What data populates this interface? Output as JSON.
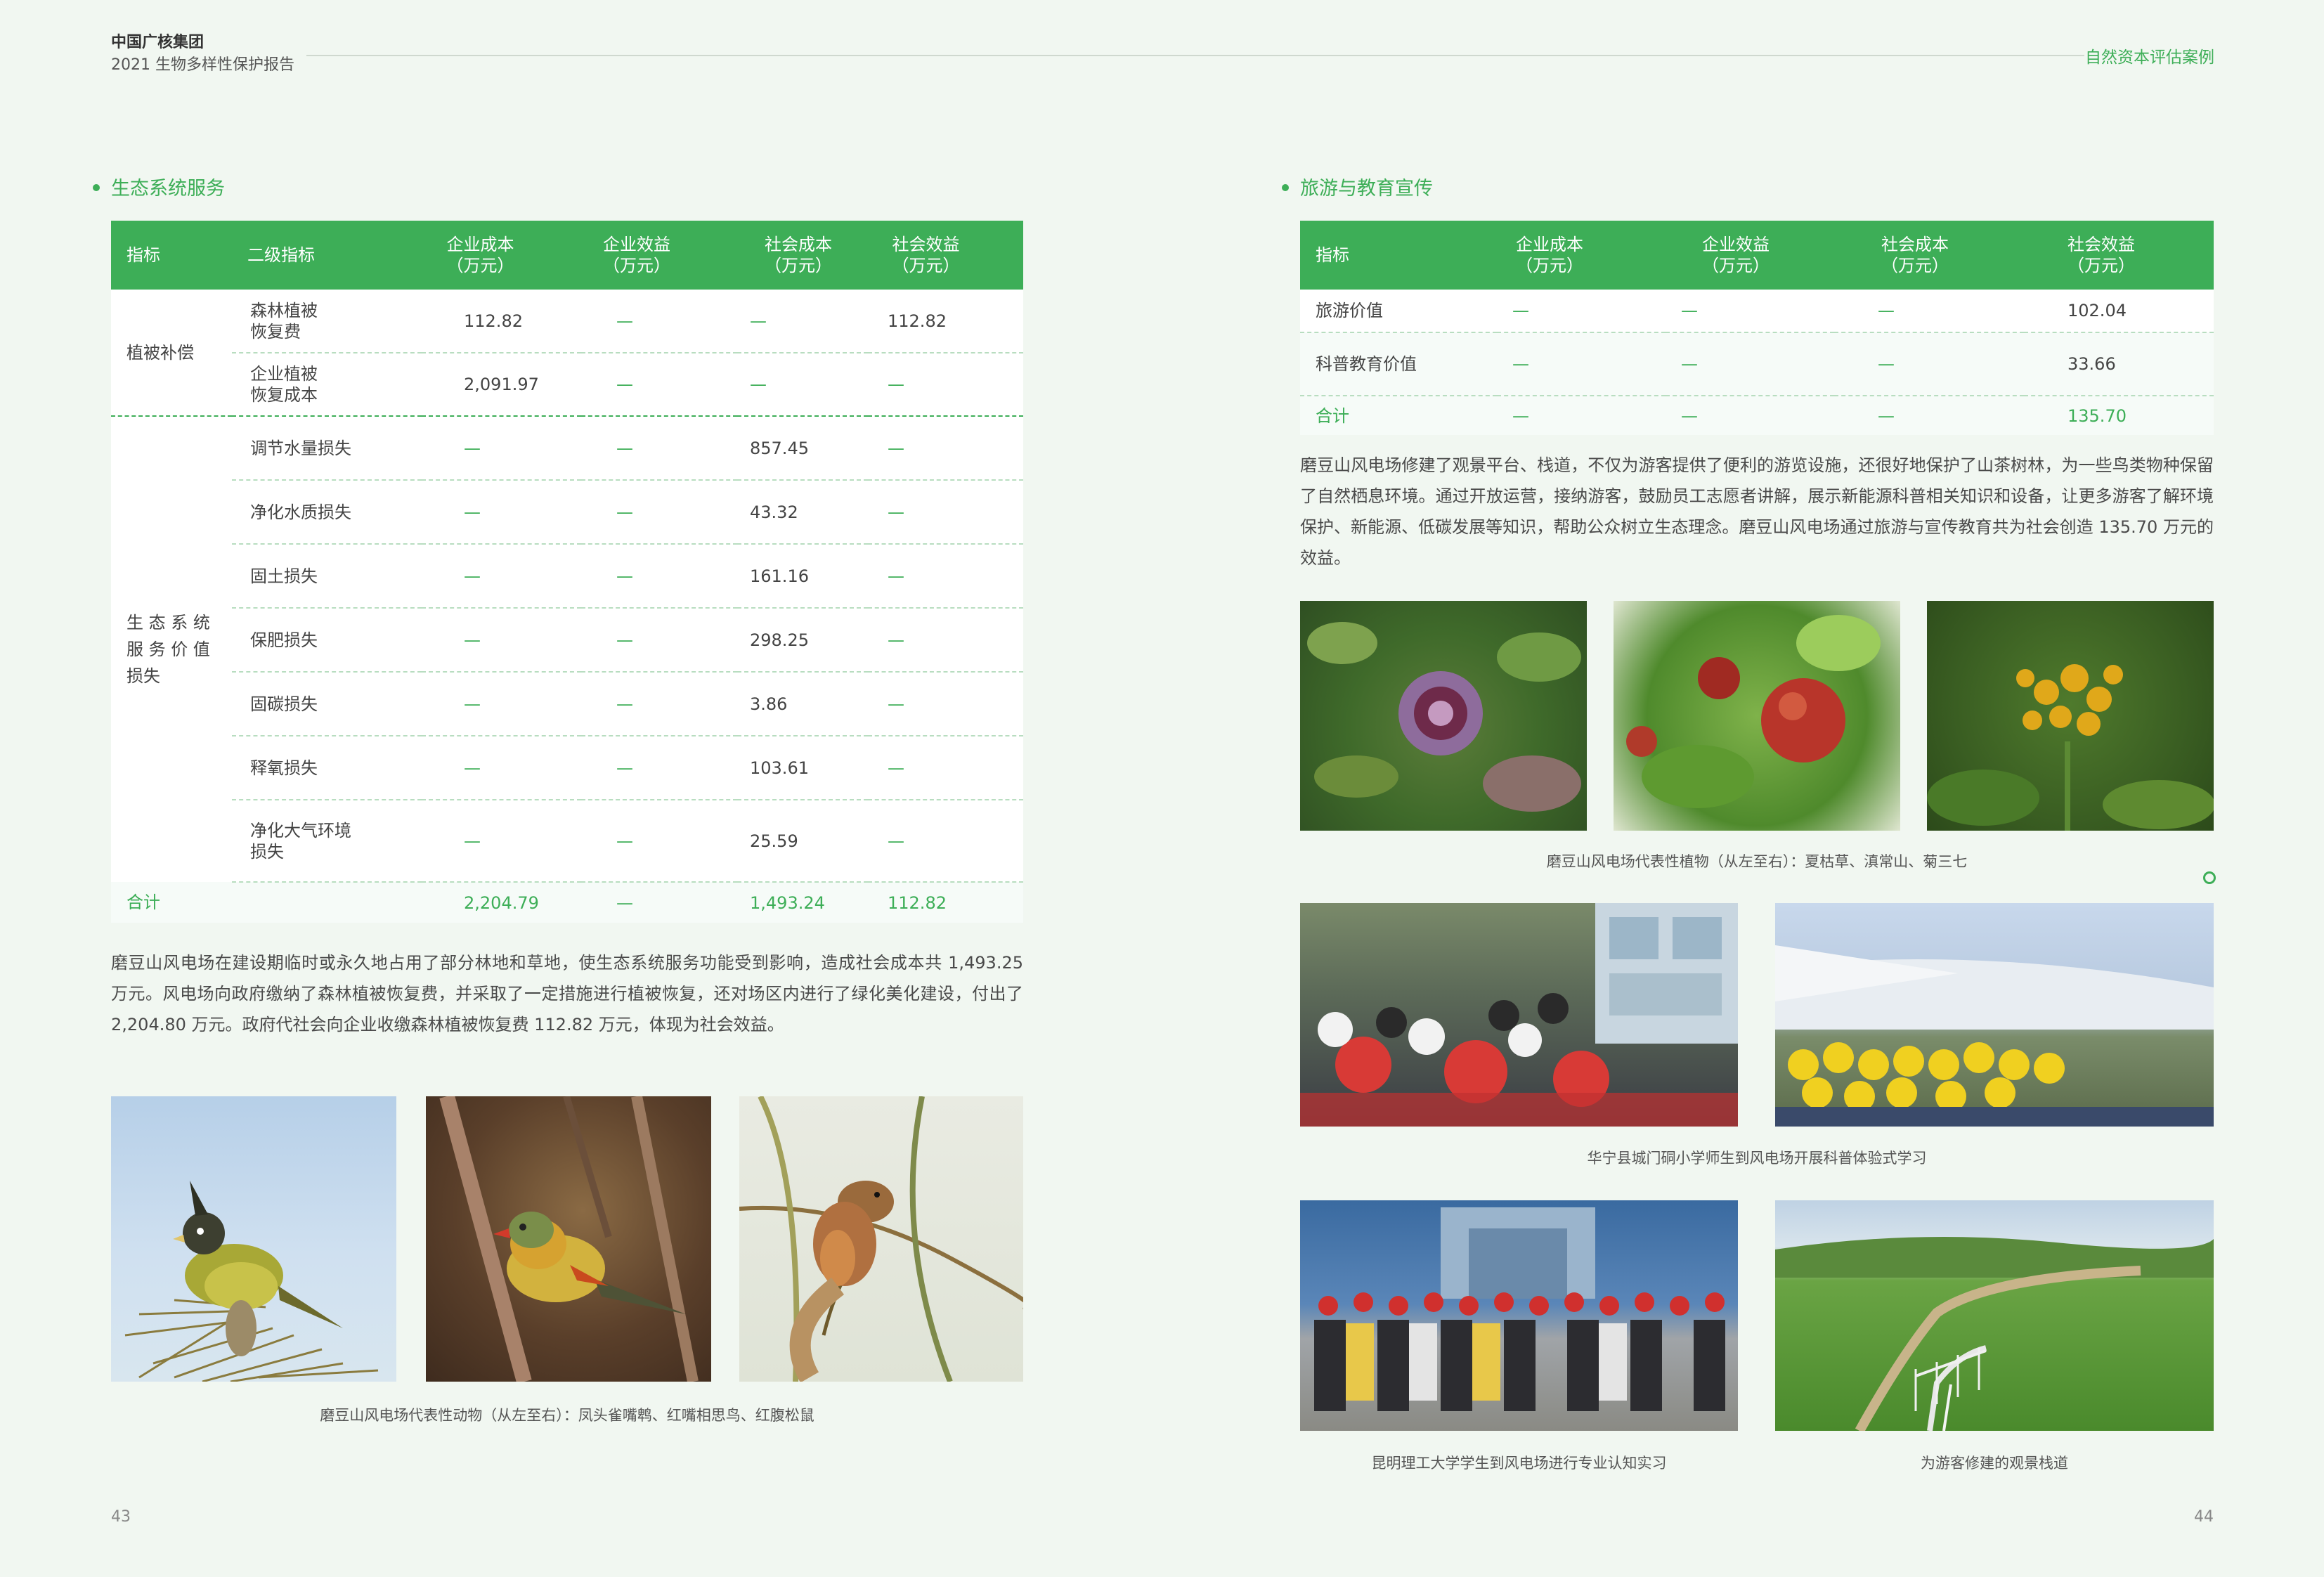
{
  "header": {
    "org": "中国广核集团",
    "report": "2021 生物多样性保护报告",
    "section": "自然资本评估案例"
  },
  "left": {
    "title": "生态系统服务",
    "table": {
      "headers": [
        "指标",
        "二级指标",
        "企业成本\n（万元）",
        "企业效益\n（万元）",
        "社会成本\n（万元）",
        "社会效益\n（万元）"
      ],
      "group1": {
        "name": "植被补偿",
        "rows": [
          {
            "name": "森林植被\n恢复费",
            "c1": "112.82",
            "c2": "—",
            "c3": "—",
            "c4": "112.82"
          },
          {
            "name": "企业植被\n恢复成本",
            "c1": "2,091.97",
            "c2": "—",
            "c3": "—",
            "c4": "—"
          }
        ]
      },
      "group2": {
        "name": "生 态 系 统\n服 务 价 值\n损失",
        "rows": [
          {
            "name": "调节水量损失",
            "c1": "—",
            "c2": "—",
            "c3": "857.45",
            "c4": "—"
          },
          {
            "name": "净化水质损失",
            "c1": "—",
            "c2": "—",
            "c3": "43.32",
            "c4": "—"
          },
          {
            "name": "固土损失",
            "c1": "—",
            "c2": "—",
            "c3": "161.16",
            "c4": "—"
          },
          {
            "name": "保肥损失",
            "c1": "—",
            "c2": "—",
            "c3": "298.25",
            "c4": "—"
          },
          {
            "name": "固碳损失",
            "c1": "—",
            "c2": "—",
            "c3": "3.86",
            "c4": "—"
          },
          {
            "name": "释氧损失",
            "c1": "—",
            "c2": "—",
            "c3": "103.61",
            "c4": "—"
          },
          {
            "name": "净化大气环境\n损失",
            "c1": "—",
            "c2": "—",
            "c3": "25.59",
            "c4": "—"
          }
        ]
      },
      "total": {
        "name": "合计",
        "c1": "2,204.79",
        "c2": "—",
        "c3": "1,493.24",
        "c4": "112.82"
      }
    },
    "paragraph": "磨豆山风电场在建设期临时或永久地占用了部分林地和草地，使生态系统服务功能受到影响，造成社会成本共 1,493.25 万元。风电场向政府缴纳了森林植被恢复费，并采取了一定措施进行植被恢复，还对场区内进行了绿化美化建设，付出了 2,204.80 万元。政府代社会向企业收缴森林植被恢复费 112.82 万元，体现为社会效益。",
    "caption": "磨豆山风电场代表性动物（从左至右）：凤头雀嘴鹎、红嘴相思鸟、红腹松鼠",
    "page": "43"
  },
  "right": {
    "title": "旅游与教育宣传",
    "table": {
      "headers": [
        "指标",
        "企业成本\n（万元）",
        "企业效益\n（万元）",
        "社会成本\n（万元）",
        "社会效益\n（万元）"
      ],
      "rows": [
        {
          "name": "旅游价值",
          "c1": "—",
          "c2": "—",
          "c3": "—",
          "c4": "102.04"
        },
        {
          "name": "科普教育价值",
          "c1": "—",
          "c2": "—",
          "c3": "—",
          "c4": "33.66"
        }
      ],
      "total": {
        "name": "合计",
        "c1": "—",
        "c2": "—",
        "c3": "—",
        "c4": "135.70"
      }
    },
    "paragraph": "磨豆山风电场修建了观景平台、栈道，不仅为游客提供了便利的游览设施，还很好地保护了山茶树林，为一些鸟类物种保留了自然栖息环境。通过开放运营，接纳游客，鼓励员工志愿者讲解，展示新能源科普相关知识和设备，让更多游客了解环境保护、新能源、低碳发展等知识，帮助公众树立生态理念。磨豆山风电场通过旅游与宣传教育共为社会创造 135.70 万元的效益。",
    "captions": {
      "plants": "磨豆山风电场代表性植物（从左至右）：夏枯草、滇常山、菊三七",
      "students": "华宁县城门硐小学师生到风电场开展科普体验式学习",
      "university": "昆明理工大学学生到风电场进行专业认知实习",
      "trail": "为游客修建的观景栈道"
    },
    "page": "44"
  }
}
